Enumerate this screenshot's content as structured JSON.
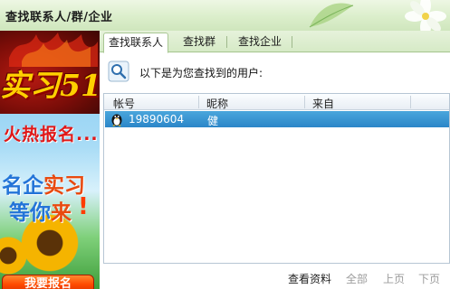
{
  "window": {
    "title": "查找联系人/群/企业"
  },
  "ad": {
    "logo": "实习51",
    "hot_text": "火热报名...",
    "line1_part1": "名企",
    "line1_part2": "实习",
    "line2_part1": "等你",
    "line2_part2": "来",
    "exclaim": "!",
    "button_label": "我要报名"
  },
  "tabs": [
    {
      "label": "查找联系人",
      "active": true
    },
    {
      "label": "查找群",
      "active": false
    },
    {
      "label": "查找企业",
      "active": false
    }
  ],
  "results": {
    "info_text": "以下是为您查找到的用户:",
    "columns": [
      "帐号",
      "昵称",
      "来自"
    ],
    "rows": [
      {
        "account": "19890604",
        "nickname": "健",
        "from": "",
        "selected": true
      }
    ]
  },
  "bottom_bar": {
    "view_profile": "查看资料",
    "all": "全部",
    "prev_page": "上页",
    "next_page": "下页"
  },
  "colors": {
    "selection": "#2b86c8",
    "frame_green": "#cfe6bd",
    "ad_button": "#ff4a00"
  }
}
